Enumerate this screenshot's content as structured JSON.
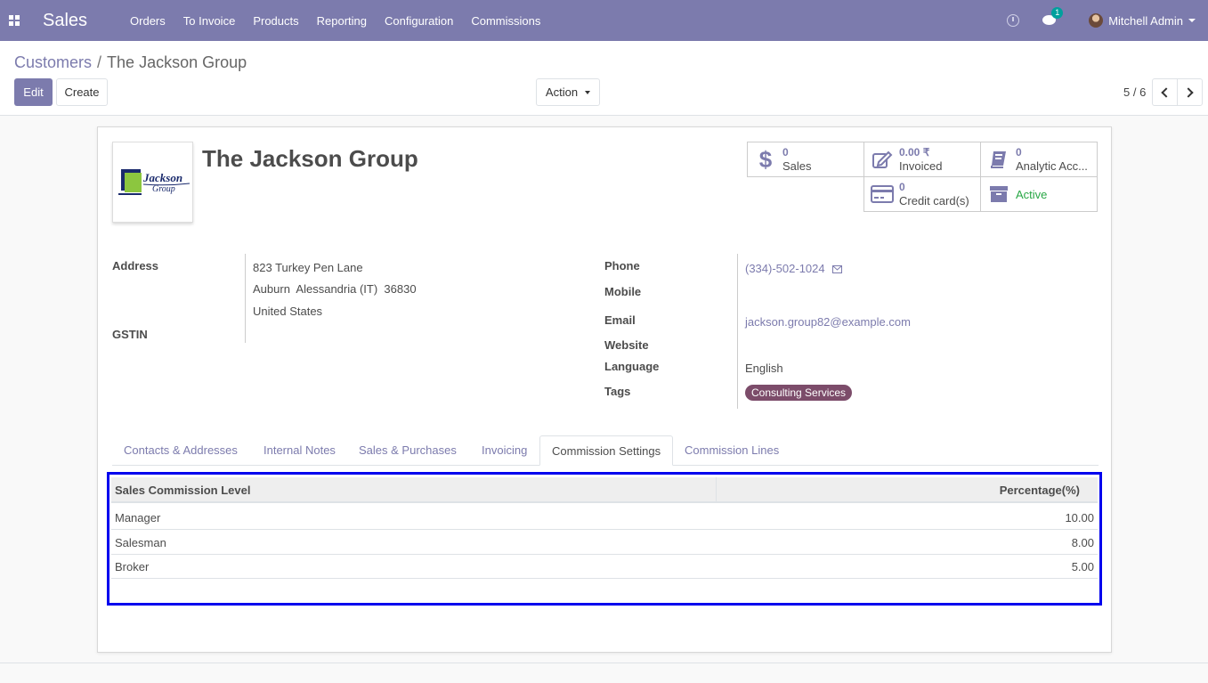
{
  "navbar": {
    "app_name": "Sales",
    "menu": [
      "Orders",
      "To Invoice",
      "Products",
      "Reporting",
      "Configuration",
      "Commissions"
    ],
    "chat_badge": "1",
    "user_name": "Mitchell Admin"
  },
  "breadcrumb": {
    "parent": "Customers",
    "separator": "/",
    "current": "The Jackson Group"
  },
  "buttons": {
    "edit": "Edit",
    "create": "Create",
    "action": "Action"
  },
  "pager": {
    "value": "5 / 6"
  },
  "partner": {
    "name": "The Jackson Group",
    "logo_text": [
      "Jackson",
      "Group"
    ]
  },
  "stat_buttons": {
    "sales": {
      "value": "0",
      "label": "Sales",
      "icon": "dollar-icon"
    },
    "invoiced": {
      "value": "0.00 ₹",
      "label": "Invoiced",
      "icon": "pencil-square-icon"
    },
    "analytic": {
      "value": "0",
      "label": "Analytic Acc...",
      "icon": "book-icon"
    },
    "credit_cards": {
      "value": "0",
      "label": "Credit card(s)",
      "icon": "credit-card-icon"
    },
    "active": {
      "label": "Active",
      "icon": "archive-icon"
    }
  },
  "fields": {
    "address_label": "Address",
    "address_line1": "823 Turkey Pen Lane",
    "address_line2": "Auburn  Alessandria (IT)  36830",
    "address_line3": "United States",
    "gstin_label": "GSTIN",
    "phone_label": "Phone",
    "phone_value": "(334)-502-1024",
    "mobile_label": "Mobile",
    "email_label": "Email",
    "email_value": "jackson.group82@example.com",
    "website_label": "Website",
    "language_label": "Language",
    "language_value": "English",
    "tags_label": "Tags",
    "tag": "Consulting Services"
  },
  "tabs": [
    "Contacts & Addresses",
    "Internal Notes",
    "Sales & Purchases",
    "Invoicing",
    "Commission Settings",
    "Commission Lines"
  ],
  "commission_table": {
    "headers": [
      "Sales Commission Level",
      "Percentage(%)"
    ],
    "rows": [
      {
        "level": "Manager",
        "percentage": "10.00"
      },
      {
        "level": "Salesman",
        "percentage": "8.00"
      },
      {
        "level": "Broker",
        "percentage": "5.00"
      }
    ]
  },
  "colors": {
    "brand": "#7c7bad",
    "highlight_border": "#0000ee",
    "tag_bg": "#7c4c6a",
    "active_green": "#28a745"
  }
}
